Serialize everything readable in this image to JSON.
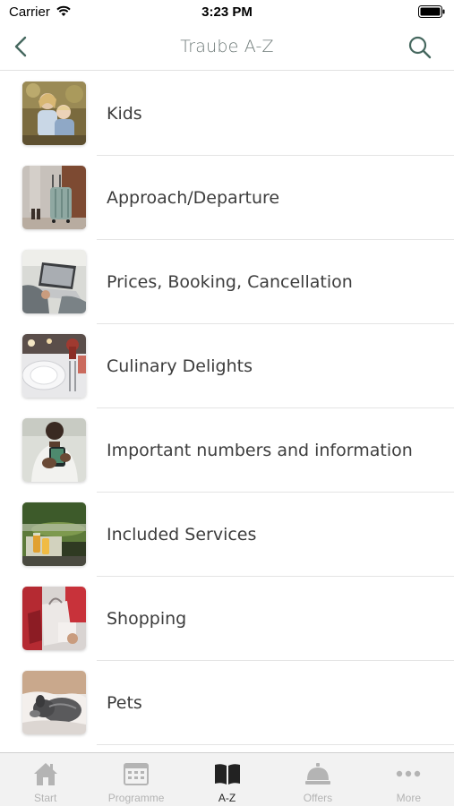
{
  "status_bar": {
    "carrier": "Carrier",
    "time": "3:23 PM"
  },
  "nav": {
    "title": "Traube A-Z"
  },
  "list": {
    "items": [
      {
        "label": "Kids",
        "image": "kids-photo"
      },
      {
        "label": "Approach/Departure",
        "image": "suitcase-photo"
      },
      {
        "label": "Prices, Booking, Cancellation",
        "image": "laptop-photo"
      },
      {
        "label": "Culinary Delights",
        "image": "table-setting-photo"
      },
      {
        "label": "Important numbers and information",
        "image": "smartphone-photo"
      },
      {
        "label": "Included Services",
        "image": "garden-drinks-photo"
      },
      {
        "label": "Shopping",
        "image": "shopping-bags-photo"
      },
      {
        "label": "Pets",
        "image": "dog-photo"
      }
    ]
  },
  "tab_bar": {
    "tabs": [
      {
        "label": "Start",
        "icon": "home-icon",
        "active": false
      },
      {
        "label": "Programme",
        "icon": "calendar-icon",
        "active": false
      },
      {
        "label": "A-Z",
        "icon": "book-icon",
        "active": true
      },
      {
        "label": "Offers",
        "icon": "service-bell-icon",
        "active": false
      },
      {
        "label": "More",
        "icon": "more-dots-icon",
        "active": false
      }
    ]
  },
  "colors": {
    "accent": "#46685f",
    "title": "#6e7a78",
    "tab_inactive": "#b4b4b4",
    "tab_active": "#222222"
  }
}
